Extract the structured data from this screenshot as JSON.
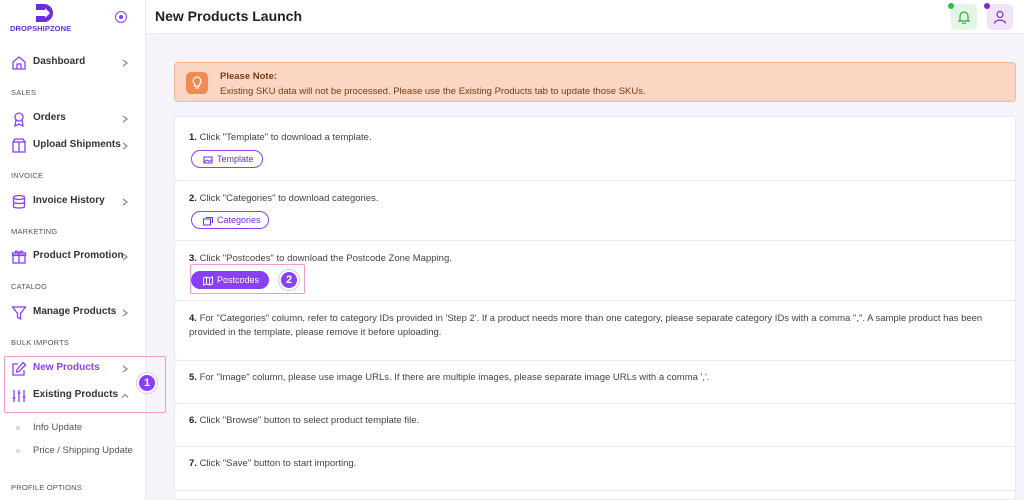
{
  "brand": {
    "name": "DROPSHIPZONE",
    "accent": "#8a3ffc"
  },
  "sidebar": {
    "items": [
      {
        "label": "Dashboard",
        "icon": "home-icon"
      },
      {
        "section": "SALES"
      },
      {
        "label": "Orders",
        "icon": "award-icon"
      },
      {
        "label": "Upload Shipments",
        "icon": "box-icon"
      },
      {
        "section": "INVOICE"
      },
      {
        "label": "Invoice History",
        "icon": "database-icon"
      },
      {
        "section": "MARKETING"
      },
      {
        "label": "Product Promotion",
        "icon": "gift-icon"
      },
      {
        "section": "CATALOG"
      },
      {
        "label": "Manage Products",
        "icon": "filter-icon"
      },
      {
        "section": "BULK IMPORTS"
      },
      {
        "label": "New Products",
        "icon": "edit-icon",
        "active": true
      },
      {
        "label": "Existing Products",
        "icon": "sliders-icon",
        "expanded": true
      },
      {
        "sub": "Info Update"
      },
      {
        "sub": "Price / Shipping Update"
      },
      {
        "section": "PROFILE OPTIONS"
      }
    ],
    "callout_badge": "1"
  },
  "header": {
    "title": "New Products Launch"
  },
  "note": {
    "title": "Please Note:",
    "text": "Existing SKU data will not be processed. Please use the Existing Products tab to update those SKUs."
  },
  "steps": [
    {
      "num": "1.",
      "text": "Click \"Template\" to download a template.",
      "button": "Template"
    },
    {
      "num": "2.",
      "text": "Click \"Categories\" to download categories.",
      "button": "Categories"
    },
    {
      "num": "3.",
      "text": "Click \"Postcodes\" to download the Postcode Zone Mapping.",
      "button": "Postcodes",
      "callout_badge": "2"
    },
    {
      "num": "4.",
      "text": "For \"Categories\" column, refer to category IDs provided in 'Step 2'. If a product needs more than one category, please separate category IDs with a comma \",\". A sample product has been provided in the template, please remove it before uploading."
    },
    {
      "num": "5.",
      "text": "For \"Image\" column, please use image URLs. If there are multiple images, please separate image URLs with a comma ','."
    },
    {
      "num": "6.",
      "text": "Click \"Browse\" button to select product template file."
    },
    {
      "num": "7.",
      "text": "Click \"Save\" button to start importing."
    }
  ]
}
